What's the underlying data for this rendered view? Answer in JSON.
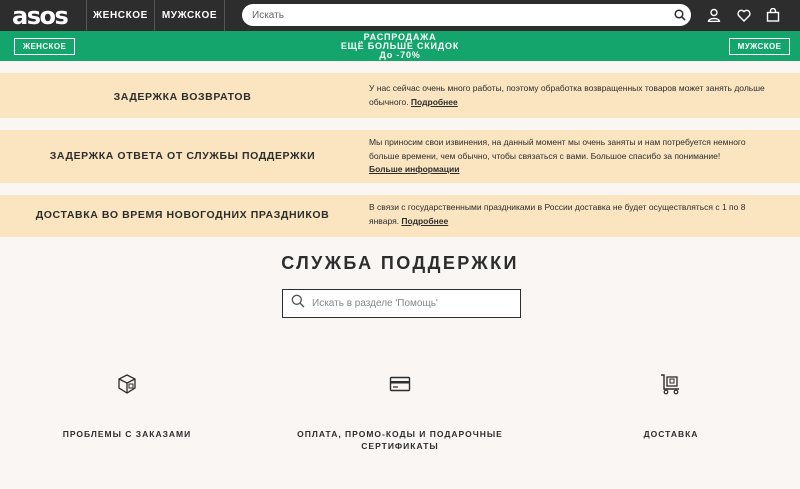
{
  "header": {
    "logo": "asos",
    "nav": [
      "ЖЕНСКОЕ",
      "МУЖСКОЕ"
    ],
    "search_placeholder": "Искать",
    "icons": [
      "user-icon",
      "heart-icon",
      "bag-icon"
    ]
  },
  "promo": {
    "left_button": "ЖЕНСКОЕ",
    "right_button": "МУЖСКОЕ",
    "line1": "РАСПРОДАЖА",
    "line2": "ЕЩЁ БОЛЬШЕ СКИДОК",
    "line3": "До -70%",
    "color": "#13a56b"
  },
  "notices": [
    {
      "title": "ЗАДЕРЖКА ВОЗВРАТОВ",
      "text": "У нас сейчас очень много работы, поэтому обработка возвращенных товаров может занять дольше обычного. ",
      "link": "Подробнее"
    },
    {
      "title": "ЗАДЕРЖКА ОТВЕТА ОТ СЛУЖБЫ ПОДДЕРЖКИ",
      "text": "Мы приносим свои извинения, на данный момент мы очень заняты и нам потребуется немного больше времени, чем обычно, чтобы связаться с вами. Большое спасибо за понимание!",
      "link": "Больше информации"
    },
    {
      "title": "ДОСТАВКА ВО ВРЕМЯ НОВОГОДНИХ ПРАЗДНИКОВ",
      "text": "В связи с государственными праздниками в России доставка не будет осуществляться с 1 по 8 января. ",
      "link": "Подробнее"
    }
  ],
  "support": {
    "title": "СЛУЖБА ПОДДЕРЖКИ",
    "search_placeholder": "Искать в разделе 'Помощь'",
    "categories": [
      {
        "label": "ПРОБЛЕМЫ С ЗАКАЗАМИ",
        "icon": "box-icon"
      },
      {
        "label": "ОПЛАТА, ПРОМО-КОДЫ И ПОДАРОЧНЫЕ СЕРТИФИКАТЫ",
        "icon": "card-icon"
      },
      {
        "label": "ДОСТАВКА",
        "icon": "delivery-cart-icon"
      }
    ]
  },
  "colors": {
    "header_bg": "#2d2d2d",
    "notice_bg": "#fae5c0",
    "page_bg": "#faf6f4"
  }
}
